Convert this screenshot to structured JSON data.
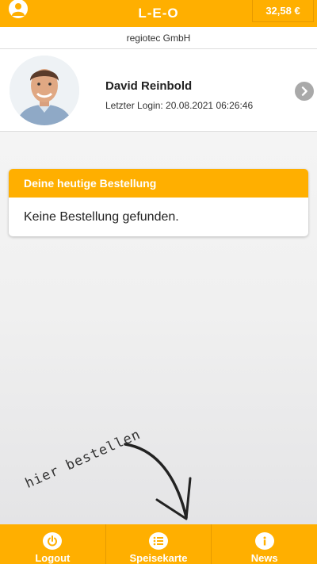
{
  "header": {
    "title": "L-E-O",
    "balance": "32,58 €",
    "user_icon": "user-icon"
  },
  "company": "regiotec GmbH",
  "profile": {
    "name": "David Reinbold",
    "last_login": "Letzter Login: 20.08.2021 06:26:46",
    "arrow_icon": "chevron-right-icon"
  },
  "order_card": {
    "title": "Deine heutige Bestellung",
    "message": "Keine Bestellung gefunden."
  },
  "hint": {
    "text": "hier bestellen"
  },
  "bottom_nav": {
    "items": [
      {
        "label": "Logout",
        "icon": "power-icon"
      },
      {
        "label": "Speisekarte",
        "icon": "list-icon"
      },
      {
        "label": "News",
        "icon": "info-icon"
      }
    ]
  },
  "colors": {
    "accent": "#ffaf00",
    "accent_border": "#e69a00",
    "text": "#222222",
    "arrow_bg": "#a9a9a9"
  }
}
